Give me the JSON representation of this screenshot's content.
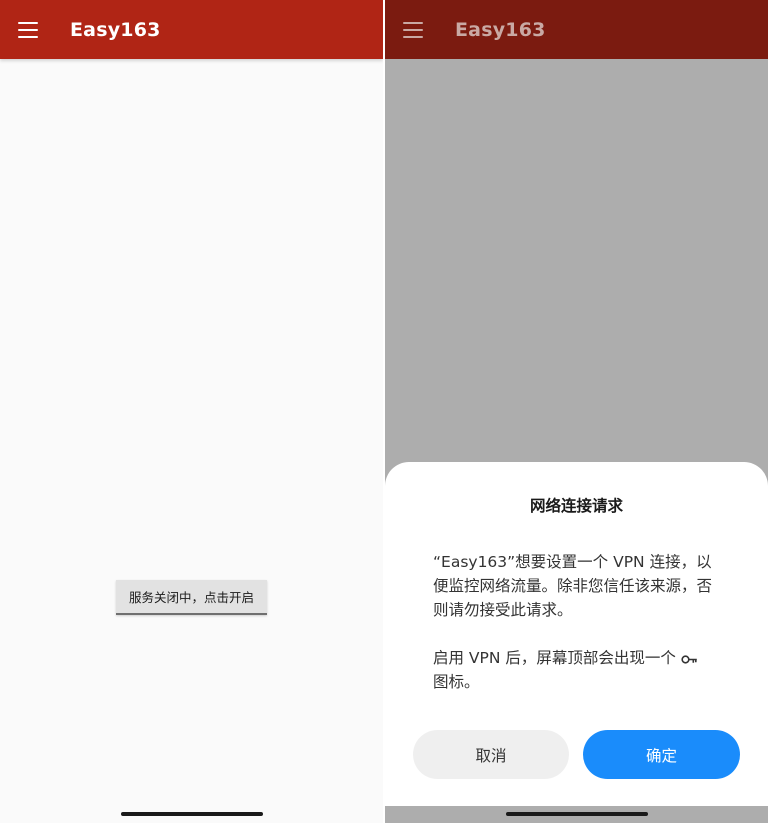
{
  "left": {
    "appbar": {
      "title": "Easy163"
    },
    "service_button": {
      "label": "服务关闭中，点击开启"
    }
  },
  "right": {
    "appbar": {
      "title": "Easy163"
    },
    "dialog": {
      "title": "网络连接请求",
      "message": "“Easy163”想要设置一个 VPN 连接，以便监控网络流量。除非您信任该来源，否则请勿接受此请求。",
      "note_prefix": "启用 VPN 后，屏幕顶部会出现一个",
      "note_suffix": "图标。",
      "note_icon": "vpn-key-icon",
      "cancel_label": "取消",
      "confirm_label": "确定"
    }
  },
  "colors": {
    "appbar": "#b02515",
    "appbar_dimmed": "#7b1b10",
    "scrim": "#adadad",
    "confirm": "#1a8cfb",
    "cancel": "#efefef"
  }
}
